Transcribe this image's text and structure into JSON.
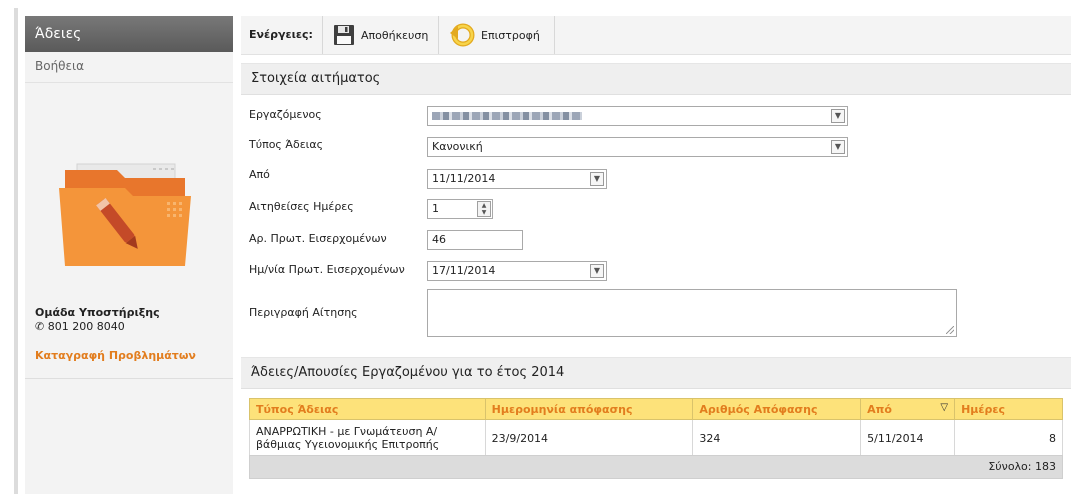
{
  "sidebar": {
    "title": "Άδειες",
    "help": "Βοήθεια",
    "support_title": "Ομάδα Υποστήριξης",
    "support_phone": "801 200 8040",
    "report_link": "Καταγραφή Προβλημάτων"
  },
  "toolbar": {
    "label": "Ενέργειες:",
    "save_label": "Αποθήκευση",
    "back_label": "Επιστροφή"
  },
  "request": {
    "section_title": "Στοιχεία αιτήματος",
    "employee_label": "Εργαζόμενος",
    "leave_type_label": "Τύπος Άδειας",
    "leave_type_value": "Κανονική",
    "from_label": "Από",
    "from_value": "11/11/2014",
    "days_label": "Αιτηθείσες Ημέρες",
    "days_value": "1",
    "protocol_no_label": "Αρ. Πρωτ. Εισερχομένων",
    "protocol_no_value": "46",
    "protocol_date_label": "Ημ/νία Πρωτ. Εισερχομένων",
    "protocol_date_value": "17/11/2014",
    "description_label": "Περιγραφή Αίτησης",
    "description_value": ""
  },
  "history": {
    "section_title": "Άδειες/Απουσίες Εργαζομένου για το έτος 2014",
    "columns": [
      "Τύπος Άδειας",
      "Ημερομηνία απόφασης",
      "Αριθμός Απόφασης",
      "Από",
      "Ημέρες"
    ],
    "rows": [
      [
        "ΑΝΑΡΡΩΤΙΚΗ - με Γνωμάτευση Α/βάθμιας Υγειονομικής Επιτροπής",
        "23/9/2014",
        "324",
        "5/11/2014",
        "8"
      ]
    ],
    "total": "Σύνολο: 183"
  },
  "colors": {
    "accent": "#e27d1e",
    "header_bg": "#fde27a",
    "sidebar_header": "#666666"
  }
}
